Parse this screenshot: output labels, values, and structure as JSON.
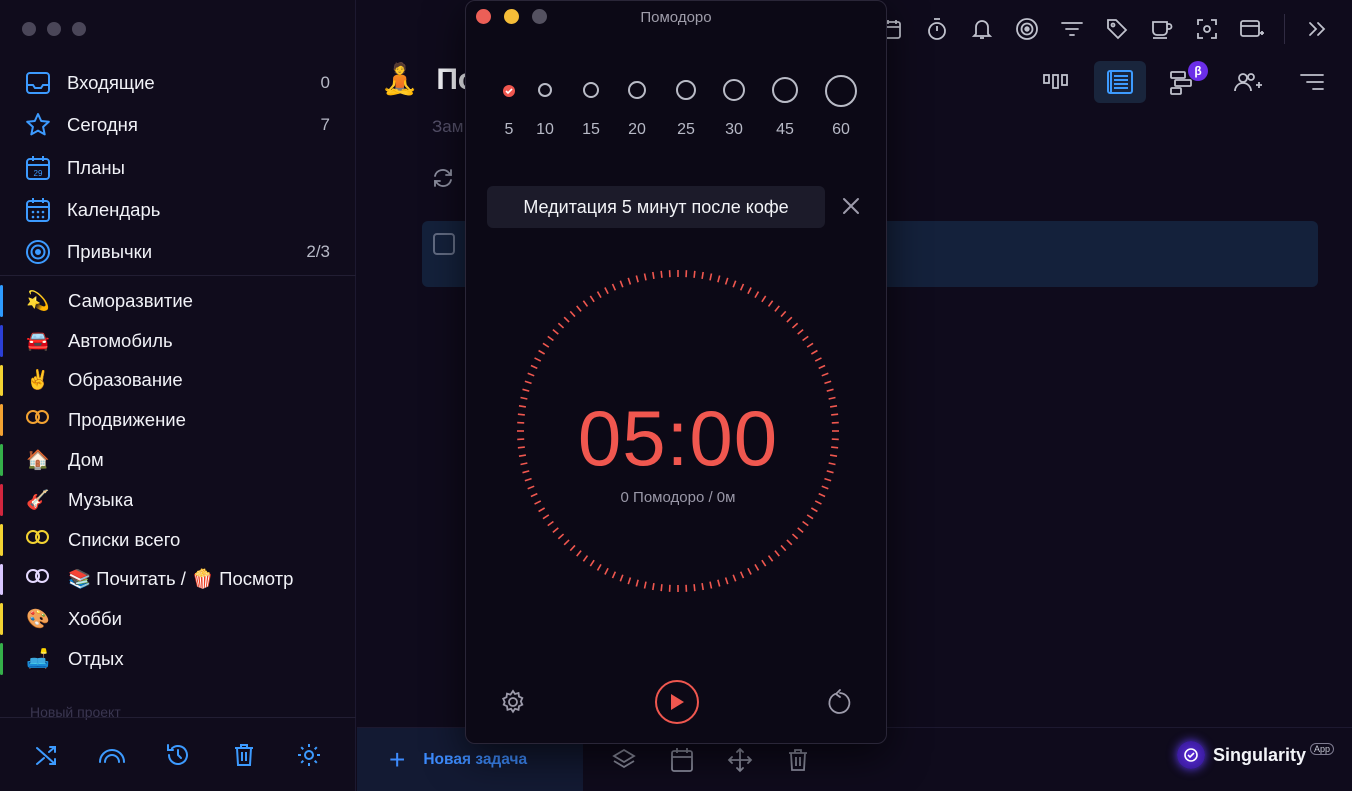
{
  "sidebar": {
    "nav": [
      {
        "label": "Входящие",
        "count": "0",
        "icon": "inbox-icon"
      },
      {
        "label": "Сегодня",
        "count": "7",
        "icon": "star-icon"
      },
      {
        "label": "Планы",
        "count": "",
        "icon": "calendar-day-icon"
      },
      {
        "label": "Календарь",
        "count": "",
        "icon": "calendar-grid-icon"
      },
      {
        "label": "Привычки",
        "count": "2/3",
        "icon": "habit-target-icon"
      }
    ],
    "projects": [
      {
        "emoji": "💫",
        "label": "Саморазвитие",
        "color": "#2e9bff"
      },
      {
        "emoji": "🚘",
        "label": "Автомобиль",
        "color": "#2b3fd6"
      },
      {
        "emoji": "✌️",
        "label": "Образование",
        "color": "#f3d332"
      },
      {
        "emoji": "",
        "label": "Продвижение",
        "color": "#f3a332"
      },
      {
        "emoji": "🏠",
        "label": "Дом",
        "color": "#35b04a"
      },
      {
        "emoji": "🎸",
        "label": "Музыка",
        "color": "#d2263e"
      },
      {
        "emoji": "",
        "label": "Списки всего",
        "color": "#f3d332"
      },
      {
        "emoji": "",
        "label": "📚 Почитать / 🍿 Посмотреть",
        "color": "#d9c7ff"
      },
      {
        "emoji": "🎨",
        "label": "Хобби",
        "color": "#f3d332"
      },
      {
        "emoji": "🛋️",
        "label": "Отдых",
        "color": "#35b04a"
      }
    ],
    "faded_label": "Новый проект"
  },
  "main": {
    "title_emoji": "🧘",
    "title": "По",
    "subtitle": "Зам",
    "new_task_label": "Новая задача",
    "brand_name": "Singularity",
    "brand_badge": "App"
  },
  "pomodoro": {
    "window_title": "Помодоро",
    "durations": [
      "5",
      "10",
      "15",
      "20",
      "25",
      "30",
      "45",
      "60"
    ],
    "selected_duration": "5",
    "task_label": "Медитация 5 минут после кофе",
    "time": "05:00",
    "stats": "0 Помодоро / 0м",
    "accent_color": "#f0574f"
  }
}
